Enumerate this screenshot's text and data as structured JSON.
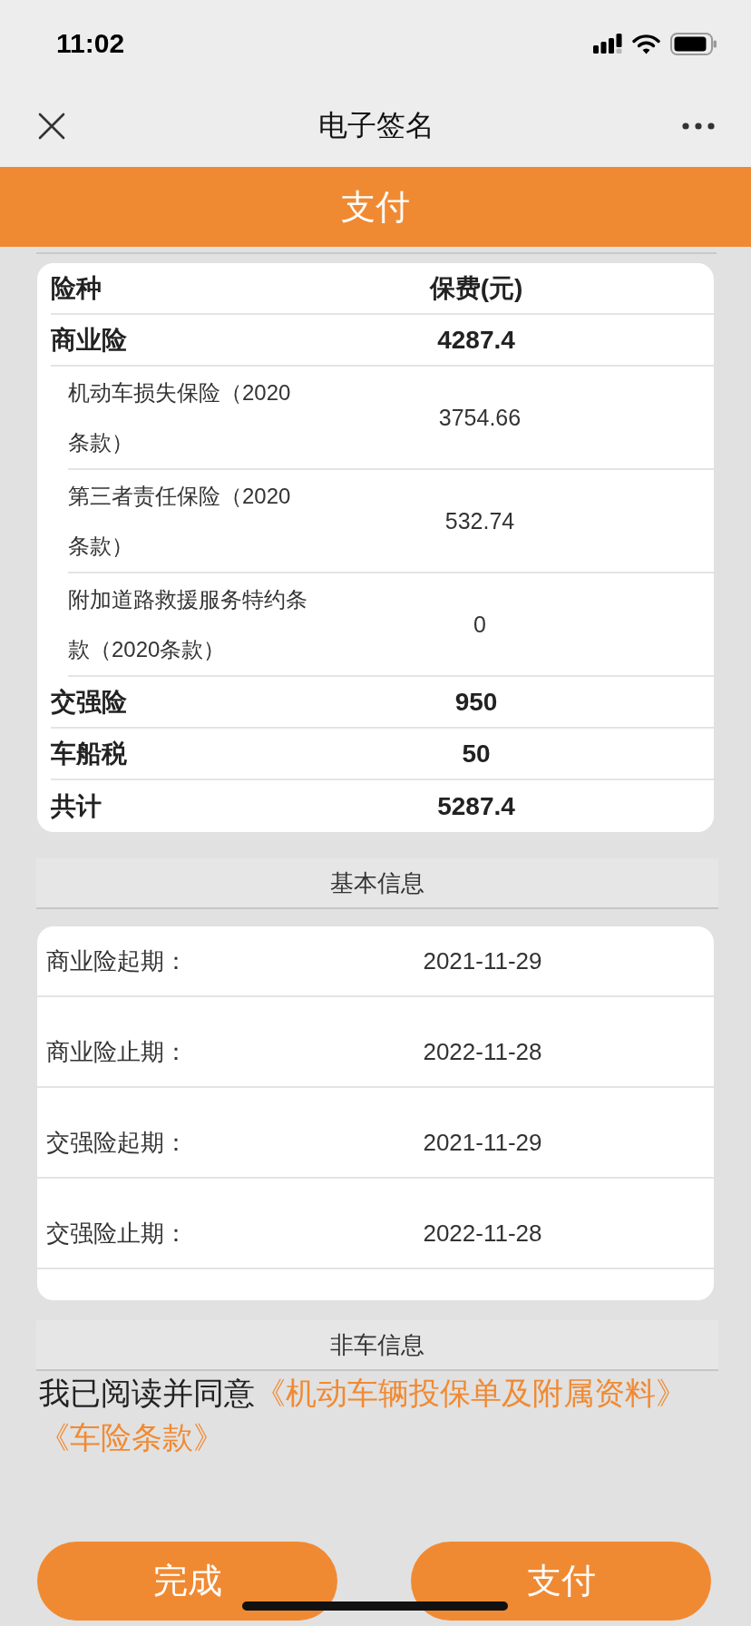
{
  "status_bar": {
    "time": "11:02"
  },
  "nav_bar": {
    "title": "电子签名"
  },
  "pay_banner": {
    "label": "支付"
  },
  "premium_table": {
    "columns": [
      "险种",
      "保费(元)"
    ],
    "rows": [
      {
        "kind": "main",
        "name": "商业险",
        "premium": "4287.4"
      },
      {
        "kind": "sub",
        "name": "机动车损失保险（2020条款）",
        "premium": "3754.66"
      },
      {
        "kind": "sub",
        "name": "第三者责任保险（2020条款）",
        "premium": "532.74"
      },
      {
        "kind": "sub",
        "name": "附加道路救援服务特约条款（2020条款）",
        "premium": "0"
      },
      {
        "kind": "main",
        "name": "交强险",
        "premium": "950"
      },
      {
        "kind": "main",
        "name": "车船税",
        "premium": "50"
      },
      {
        "kind": "main",
        "name": "共计",
        "premium": "5287.4"
      }
    ]
  },
  "basic_info": {
    "title": "基本信息",
    "rows": [
      {
        "label": "商业险起期：",
        "value": "2021-11-29"
      },
      {
        "label": "商业险止期：",
        "value": "2022-11-28"
      },
      {
        "label": "交强险起期：",
        "value": "2021-11-29"
      },
      {
        "label": "交强险止期：",
        "value": "2022-11-28"
      }
    ]
  },
  "non_vehicle_info": {
    "title": "非车信息"
  },
  "agreement": {
    "text": "我已阅读并同意",
    "links": [
      "《机动车辆投保单及附属资料》",
      "《车险条款》"
    ]
  },
  "buttons": [
    {
      "label": "完成"
    },
    {
      "label": "支付"
    }
  ]
}
